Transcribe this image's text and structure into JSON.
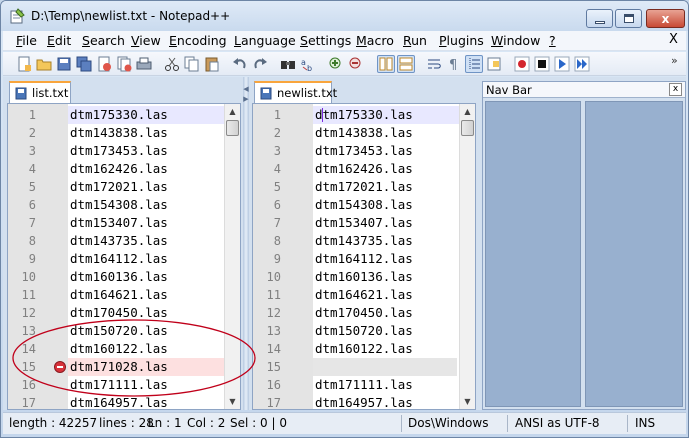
{
  "window": {
    "title": "D:\\Temp\\newlist.txt - Notepad++",
    "close_glyph": "x"
  },
  "menu": {
    "items": [
      "File",
      "Edit",
      "Search",
      "View",
      "Encoding",
      "Language",
      "Settings",
      "Macro",
      "Run",
      "Plugins",
      "Window",
      "?"
    ],
    "close_label": "X"
  },
  "toolbar": {
    "overflow": "»",
    "icons": [
      "new-file-icon",
      "open-file-icon",
      "save-icon",
      "save-all-icon",
      "close-icon",
      "close-all-icon",
      "print-icon",
      "cut-icon",
      "copy-icon",
      "paste-icon",
      "undo-icon",
      "redo-icon",
      "find-icon",
      "replace-icon",
      "zoom-in-icon",
      "zoom-out-icon",
      "sync-vertical-icon",
      "sync-horizontal-icon",
      "word-wrap-icon",
      "show-all-chars-icon",
      "indent-guide-icon",
      "doc-map-icon",
      "record-macro-icon",
      "stop-macro-icon",
      "play-macro-icon",
      "run-macro-multiple-icon"
    ]
  },
  "left_pane": {
    "tab_label": "list.txt",
    "lines": [
      {
        "num": "1",
        "text": "dtm175330.las"
      },
      {
        "num": "2",
        "text": "dtm143838.las"
      },
      {
        "num": "3",
        "text": "dtm173453.las"
      },
      {
        "num": "4",
        "text": "dtm162426.las"
      },
      {
        "num": "5",
        "text": "dtm172021.las"
      },
      {
        "num": "6",
        "text": "dtm154308.las"
      },
      {
        "num": "7",
        "text": "dtm153407.las"
      },
      {
        "num": "8",
        "text": "dtm143735.las"
      },
      {
        "num": "9",
        "text": "dtm164112.las"
      },
      {
        "num": "10",
        "text": "dtm160136.las"
      },
      {
        "num": "11",
        "text": "dtm164621.las"
      },
      {
        "num": "12",
        "text": "dtm170450.las"
      },
      {
        "num": "13",
        "text": "dtm150720.las"
      },
      {
        "num": "14",
        "text": "dtm160122.las"
      },
      {
        "num": "15",
        "text": "dtm171028.las"
      },
      {
        "num": "16",
        "text": "dtm171111.las"
      },
      {
        "num": "17",
        "text": "dtm164957.las"
      }
    ]
  },
  "right_pane": {
    "tab_label": "newlist.txt",
    "lines": [
      {
        "num": "1",
        "text": "dtm175330.las"
      },
      {
        "num": "2",
        "text": "dtm143838.las"
      },
      {
        "num": "3",
        "text": "dtm173453.las"
      },
      {
        "num": "4",
        "text": "dtm162426.las"
      },
      {
        "num": "5",
        "text": "dtm172021.las"
      },
      {
        "num": "6",
        "text": "dtm154308.las"
      },
      {
        "num": "7",
        "text": "dtm153407.las"
      },
      {
        "num": "8",
        "text": "dtm143735.las"
      },
      {
        "num": "9",
        "text": "dtm164112.las"
      },
      {
        "num": "10",
        "text": "dtm160136.las"
      },
      {
        "num": "11",
        "text": "dtm164621.las"
      },
      {
        "num": "12",
        "text": "dtm170450.las"
      },
      {
        "num": "13",
        "text": "dtm150720.las"
      },
      {
        "num": "14",
        "text": "dtm160122.las"
      },
      {
        "num": "15",
        "text": ""
      },
      {
        "num": "16",
        "text": "dtm171111.las"
      },
      {
        "num": "17",
        "text": "dtm164957.las"
      }
    ]
  },
  "navbar": {
    "title": "Nav Bar",
    "close_glyph": "x"
  },
  "status": {
    "length": "length : 42257",
    "lines": "lines : 28",
    "ln": "Ln : 1",
    "col": "Col : 2",
    "sel": "Sel : 0 | 0",
    "eol": "Dos\\Windows",
    "encoding": "ANSI as UTF-8",
    "mode": "INS"
  },
  "colors": {
    "tab_accent": "#f9a53c",
    "deleted_line": "#fde0e0",
    "blank_line": "#e6e6e6",
    "current_line": "#e8e8ff",
    "nav_pane": "#98b0cf",
    "annotation": "#c0001a"
  }
}
